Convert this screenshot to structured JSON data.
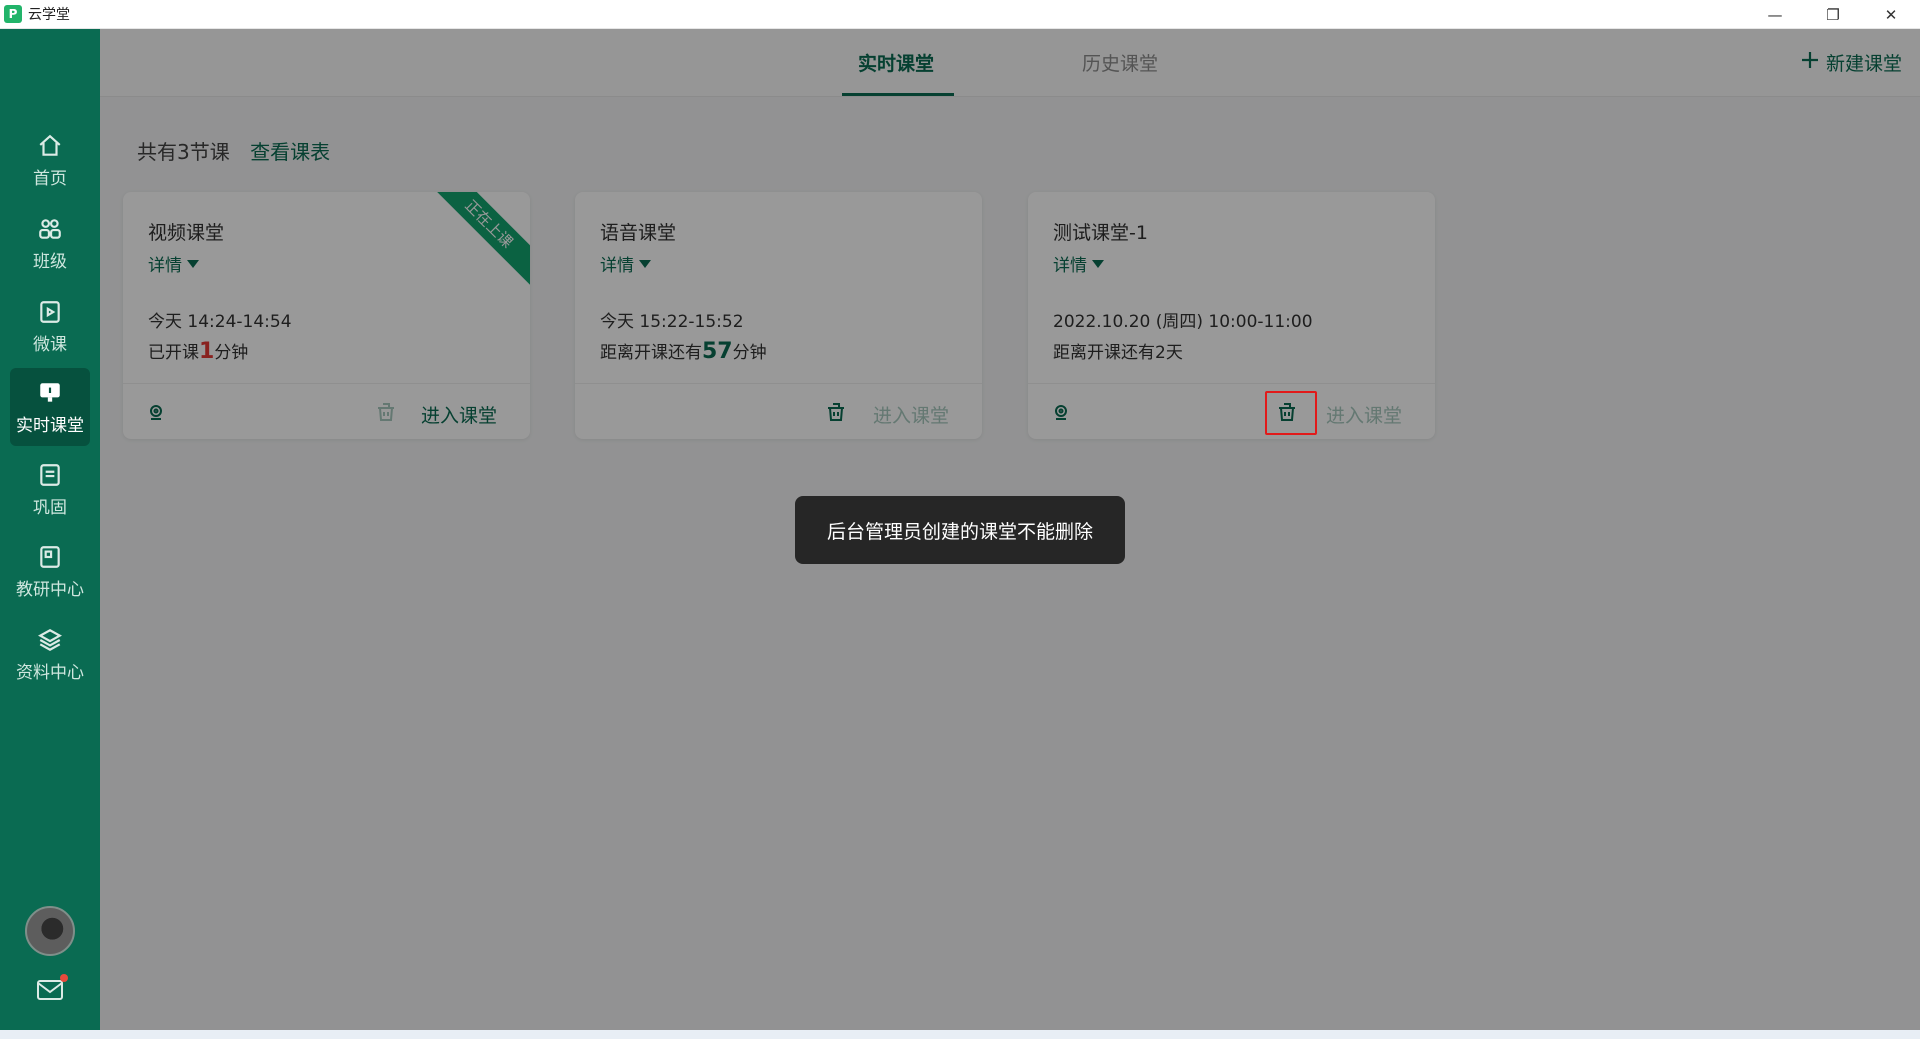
{
  "window": {
    "title": "云学堂",
    "logo_glyph": "P",
    "controls": [
      "—",
      "❐",
      "✕"
    ]
  },
  "sidebar": {
    "items": [
      {
        "label": "首页",
        "icon": "home-icon"
      },
      {
        "label": "班级",
        "icon": "class-group-icon"
      },
      {
        "label": "微课",
        "icon": "micro-lesson-icon"
      },
      {
        "label": "实时课堂",
        "icon": "live-class-icon",
        "active": true
      },
      {
        "label": "巩固",
        "icon": "consolidate-icon"
      },
      {
        "label": "教研中心",
        "icon": "research-icon"
      },
      {
        "label": "资料中心",
        "icon": "materials-icon"
      }
    ],
    "has_unread_mail": true
  },
  "topbar": {
    "tabs": [
      {
        "label": "实时课堂",
        "active": true
      },
      {
        "label": "历史课堂",
        "active": false
      }
    ],
    "new_class_label": "新建课堂"
  },
  "summary": {
    "count_text": "共有3节课",
    "schedule_link": "查看课表"
  },
  "cards": [
    {
      "title": "视频课堂",
      "detail": "详情",
      "time": "今天 14:24-14:54",
      "status_prefix": "已开课",
      "status_num": "1",
      "status_suffix": "分钟",
      "ribbon": "正在上课",
      "enter": "进入课堂"
    },
    {
      "title": "语音课堂",
      "detail": "详情",
      "time": "今天 15:22-15:52",
      "status_prefix": "距离开课还有",
      "status_num": "57",
      "status_suffix": "分钟",
      "enter": "进入课堂"
    },
    {
      "title": "测试课堂-1",
      "detail": "详情",
      "time": "2022.10.20 (周四) 10:00-11:00",
      "status_text": "距离开课还有2天",
      "enter": "进入课堂"
    }
  ],
  "toast": {
    "message": "后台管理员创建的课堂不能删除"
  },
  "colors": {
    "brand": "#0a6b52",
    "accent_red": "#e53935",
    "ribbon": "#13a36f"
  }
}
